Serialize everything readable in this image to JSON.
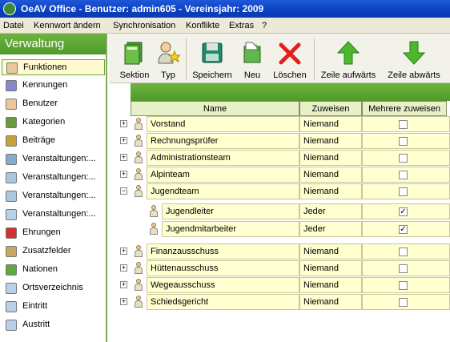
{
  "window": {
    "title": "OeAV Office - Benutzer: admin605 - Vereinsjahr: 2009"
  },
  "menu": [
    "Datei",
    "Kennwort ändern",
    "Synchronisation",
    "Konflikte",
    "Extras",
    "?"
  ],
  "sidebar": {
    "header": "Verwaltung",
    "items": [
      {
        "label": "Funktionen",
        "icon": "user-icon",
        "active": true
      },
      {
        "label": "Kennungen",
        "icon": "pen-icon"
      },
      {
        "label": "Benutzer",
        "icon": "user-icon"
      },
      {
        "label": "Kategorien",
        "icon": "gear-icon"
      },
      {
        "label": "Beiträge",
        "icon": "money-icon"
      },
      {
        "label": "Veranstaltungen:...",
        "icon": "calendar-icon"
      },
      {
        "label": "Veranstaltungen:...",
        "icon": "calendar-person-icon"
      },
      {
        "label": "Veranstaltungen:...",
        "icon": "calendar-person-icon"
      },
      {
        "label": "Veranstaltungen:...",
        "icon": "document-icon"
      },
      {
        "label": "Ehrungen",
        "icon": "ribbon-icon"
      },
      {
        "label": "Zusatzfelder",
        "icon": "edit-icon"
      },
      {
        "label": "Nationen",
        "icon": "flag-icon"
      },
      {
        "label": "Ortsverzeichnis",
        "icon": "document-icon"
      },
      {
        "label": "Eintritt",
        "icon": "document-icon"
      },
      {
        "label": "Austritt",
        "icon": "document-icon"
      }
    ]
  },
  "toolbar": {
    "sektion": "Sektion",
    "typ": "Typ",
    "speichern": "Speichern",
    "neu": "Neu",
    "loeschen": "Löschen",
    "zeile_auf": "Zeile aufwärts",
    "zeile_ab": "Zeile abwärts"
  },
  "grid": {
    "columns": {
      "name": "Name",
      "zuweisen": "Zuweisen",
      "mehrere": "Mehrere zuweisen"
    },
    "rows": [
      {
        "name": "Vorstand",
        "zuweisen": "Niemand",
        "mehrere": false,
        "level": 0,
        "expander": "+"
      },
      {
        "name": "Rechnungsprüfer",
        "zuweisen": "Niemand",
        "mehrere": false,
        "level": 0,
        "expander": "+"
      },
      {
        "name": "Administrationsteam",
        "zuweisen": "Niemand",
        "mehrere": false,
        "level": 0,
        "expander": "+"
      },
      {
        "name": "Alpinteam",
        "zuweisen": "Niemand",
        "mehrere": false,
        "level": 0,
        "expander": "+"
      },
      {
        "name": "Jugendteam",
        "zuweisen": "Niemand",
        "mehrere": false,
        "level": 0,
        "expander": "−"
      },
      {
        "name": "Jugendleiter",
        "zuweisen": "Jeder",
        "mehrere": true,
        "level": 1
      },
      {
        "name": "Jugendmitarbeiter",
        "zuweisen": "Jeder",
        "mehrere": true,
        "level": 1
      },
      {
        "name": "Finanzausschuss",
        "zuweisen": "Niemand",
        "mehrere": false,
        "level": 0,
        "expander": "+"
      },
      {
        "name": "Hüttenausschuss",
        "zuweisen": "Niemand",
        "mehrere": false,
        "level": 0,
        "expander": "+"
      },
      {
        "name": "Wegeausschuss",
        "zuweisen": "Niemand",
        "mehrere": false,
        "level": 0,
        "expander": "+"
      },
      {
        "name": "Schiedsgericht",
        "zuweisen": "Niemand",
        "mehrere": false,
        "level": 0,
        "expander": "+"
      }
    ]
  },
  "colors": {
    "accent": "#5aa632",
    "titlebar": "#0a3fc0",
    "row": "#ffffd0"
  }
}
